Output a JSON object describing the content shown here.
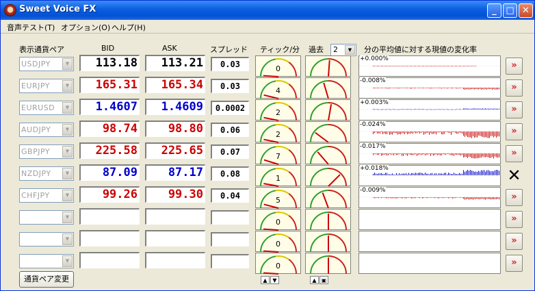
{
  "window": {
    "title": "Sweet Voice FX",
    "minimize_label": "_",
    "maximize_label": "□",
    "close_label": "✕"
  },
  "menu": [
    {
      "label": "音声テスト(T)"
    },
    {
      "label": "オプション(O)"
    },
    {
      "label": "ヘルプ(H)"
    }
  ],
  "headers": {
    "pair": "表示通貨ペア",
    "bid": "BID",
    "ask": "ASK",
    "spread": "スプレッド",
    "tick": "ティック/分",
    "past": "過去",
    "change": "分の平均値に対する現値の変化率"
  },
  "past_select": {
    "value": "2"
  },
  "colors": {
    "up": "#0000cc",
    "down": "#cc0000",
    "neutral": "#000000"
  },
  "rows": [
    {
      "pair": "USDJPY",
      "bid": "113.18",
      "ask": "113.21",
      "spread": "0.03",
      "ticks": 0,
      "tick_text": "0",
      "needle": 0.05,
      "pct": "+0.000%",
      "color": "neutral",
      "action": "»"
    },
    {
      "pair": "EURJPY",
      "bid": "165.31",
      "ask": "165.34",
      "spread": "0.03",
      "ticks": 4,
      "tick_text": "4",
      "needle": -0.2,
      "pct": "-0.008%",
      "color": "down",
      "action": "»"
    },
    {
      "pair": "EURUSD",
      "bid": "1.4607",
      "ask": "1.4609",
      "spread": "0.0002",
      "ticks": 2,
      "tick_text": "2",
      "needle": 0.12,
      "pct": "+0.003%",
      "color": "up",
      "action": "»"
    },
    {
      "pair": "AUDJPY",
      "bid": "98.74",
      "ask": "98.80",
      "spread": "0.06",
      "ticks": 2,
      "tick_text": "2",
      "needle": -0.65,
      "pct": "-0.024%",
      "color": "down",
      "action": "»"
    },
    {
      "pair": "GBPJPY",
      "bid": "225.58",
      "ask": "225.65",
      "spread": "0.07",
      "ticks": 7,
      "tick_text": "7",
      "needle": -0.5,
      "pct": "-0.017%",
      "color": "down",
      "action": "»"
    },
    {
      "pair": "NZDJPY",
      "bid": "87.09",
      "ask": "87.17",
      "spread": "0.08",
      "ticks": 1,
      "tick_text": "1",
      "needle": 0.55,
      "pct": "+0.018%",
      "color": "up",
      "action": "✕"
    },
    {
      "pair": "CHFJPY",
      "bid": "99.26",
      "ask": "99.30",
      "spread": "0.04",
      "ticks": 5,
      "tick_text": "5",
      "needle": -0.25,
      "pct": "-0.009%",
      "color": "down",
      "action": "»"
    },
    {
      "pair": "",
      "bid": "",
      "ask": "",
      "spread": "",
      "ticks": 0,
      "tick_text": "0",
      "needle": 0,
      "pct": "",
      "color": "neutral",
      "action": "»"
    },
    {
      "pair": "",
      "bid": "",
      "ask": "",
      "spread": "",
      "ticks": 0,
      "tick_text": "0",
      "needle": 0,
      "pct": "",
      "color": "neutral",
      "action": "»"
    },
    {
      "pair": "",
      "bid": "",
      "ask": "",
      "spread": "",
      "ticks": 0,
      "tick_text": "0",
      "needle": 0,
      "pct": "",
      "color": "neutral",
      "action": "»"
    }
  ],
  "footer": {
    "change_pair_button": "通貨ペア変更"
  }
}
